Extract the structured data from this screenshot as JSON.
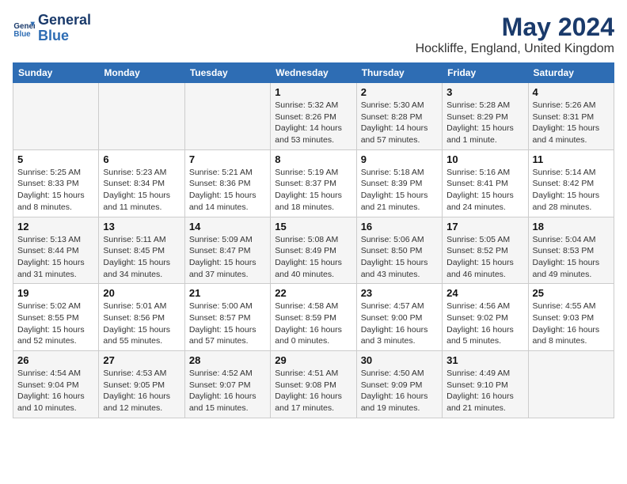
{
  "header": {
    "logo_line1": "General",
    "logo_line2": "Blue",
    "main_title": "May 2024",
    "subtitle": "Hockliffe, England, United Kingdom"
  },
  "columns": [
    "Sunday",
    "Monday",
    "Tuesday",
    "Wednesday",
    "Thursday",
    "Friday",
    "Saturday"
  ],
  "rows": [
    [
      {
        "day": "",
        "info": ""
      },
      {
        "day": "",
        "info": ""
      },
      {
        "day": "",
        "info": ""
      },
      {
        "day": "1",
        "info": "Sunrise: 5:32 AM\nSunset: 8:26 PM\nDaylight: 14 hours and 53 minutes."
      },
      {
        "day": "2",
        "info": "Sunrise: 5:30 AM\nSunset: 8:28 PM\nDaylight: 14 hours and 57 minutes."
      },
      {
        "day": "3",
        "info": "Sunrise: 5:28 AM\nSunset: 8:29 PM\nDaylight: 15 hours and 1 minute."
      },
      {
        "day": "4",
        "info": "Sunrise: 5:26 AM\nSunset: 8:31 PM\nDaylight: 15 hours and 4 minutes."
      }
    ],
    [
      {
        "day": "5",
        "info": "Sunrise: 5:25 AM\nSunset: 8:33 PM\nDaylight: 15 hours and 8 minutes."
      },
      {
        "day": "6",
        "info": "Sunrise: 5:23 AM\nSunset: 8:34 PM\nDaylight: 15 hours and 11 minutes."
      },
      {
        "day": "7",
        "info": "Sunrise: 5:21 AM\nSunset: 8:36 PM\nDaylight: 15 hours and 14 minutes."
      },
      {
        "day": "8",
        "info": "Sunrise: 5:19 AM\nSunset: 8:37 PM\nDaylight: 15 hours and 18 minutes."
      },
      {
        "day": "9",
        "info": "Sunrise: 5:18 AM\nSunset: 8:39 PM\nDaylight: 15 hours and 21 minutes."
      },
      {
        "day": "10",
        "info": "Sunrise: 5:16 AM\nSunset: 8:41 PM\nDaylight: 15 hours and 24 minutes."
      },
      {
        "day": "11",
        "info": "Sunrise: 5:14 AM\nSunset: 8:42 PM\nDaylight: 15 hours and 28 minutes."
      }
    ],
    [
      {
        "day": "12",
        "info": "Sunrise: 5:13 AM\nSunset: 8:44 PM\nDaylight: 15 hours and 31 minutes."
      },
      {
        "day": "13",
        "info": "Sunrise: 5:11 AM\nSunset: 8:45 PM\nDaylight: 15 hours and 34 minutes."
      },
      {
        "day": "14",
        "info": "Sunrise: 5:09 AM\nSunset: 8:47 PM\nDaylight: 15 hours and 37 minutes."
      },
      {
        "day": "15",
        "info": "Sunrise: 5:08 AM\nSunset: 8:49 PM\nDaylight: 15 hours and 40 minutes."
      },
      {
        "day": "16",
        "info": "Sunrise: 5:06 AM\nSunset: 8:50 PM\nDaylight: 15 hours and 43 minutes."
      },
      {
        "day": "17",
        "info": "Sunrise: 5:05 AM\nSunset: 8:52 PM\nDaylight: 15 hours and 46 minutes."
      },
      {
        "day": "18",
        "info": "Sunrise: 5:04 AM\nSunset: 8:53 PM\nDaylight: 15 hours and 49 minutes."
      }
    ],
    [
      {
        "day": "19",
        "info": "Sunrise: 5:02 AM\nSunset: 8:55 PM\nDaylight: 15 hours and 52 minutes."
      },
      {
        "day": "20",
        "info": "Sunrise: 5:01 AM\nSunset: 8:56 PM\nDaylight: 15 hours and 55 minutes."
      },
      {
        "day": "21",
        "info": "Sunrise: 5:00 AM\nSunset: 8:57 PM\nDaylight: 15 hours and 57 minutes."
      },
      {
        "day": "22",
        "info": "Sunrise: 4:58 AM\nSunset: 8:59 PM\nDaylight: 16 hours and 0 minutes."
      },
      {
        "day": "23",
        "info": "Sunrise: 4:57 AM\nSunset: 9:00 PM\nDaylight: 16 hours and 3 minutes."
      },
      {
        "day": "24",
        "info": "Sunrise: 4:56 AM\nSunset: 9:02 PM\nDaylight: 16 hours and 5 minutes."
      },
      {
        "day": "25",
        "info": "Sunrise: 4:55 AM\nSunset: 9:03 PM\nDaylight: 16 hours and 8 minutes."
      }
    ],
    [
      {
        "day": "26",
        "info": "Sunrise: 4:54 AM\nSunset: 9:04 PM\nDaylight: 16 hours and 10 minutes."
      },
      {
        "day": "27",
        "info": "Sunrise: 4:53 AM\nSunset: 9:05 PM\nDaylight: 16 hours and 12 minutes."
      },
      {
        "day": "28",
        "info": "Sunrise: 4:52 AM\nSunset: 9:07 PM\nDaylight: 16 hours and 15 minutes."
      },
      {
        "day": "29",
        "info": "Sunrise: 4:51 AM\nSunset: 9:08 PM\nDaylight: 16 hours and 17 minutes."
      },
      {
        "day": "30",
        "info": "Sunrise: 4:50 AM\nSunset: 9:09 PM\nDaylight: 16 hours and 19 minutes."
      },
      {
        "day": "31",
        "info": "Sunrise: 4:49 AM\nSunset: 9:10 PM\nDaylight: 16 hours and 21 minutes."
      },
      {
        "day": "",
        "info": ""
      }
    ]
  ]
}
